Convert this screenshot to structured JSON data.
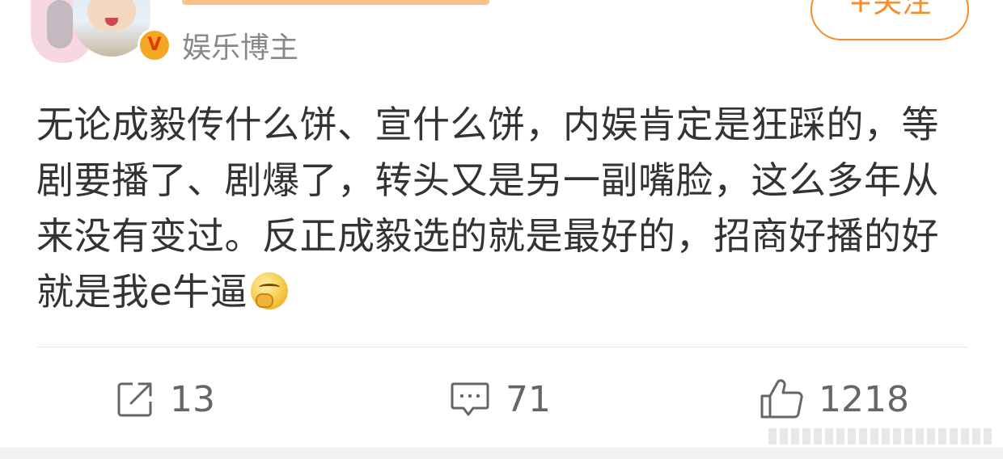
{
  "header": {
    "role": "娱乐博主",
    "verified_badge": "V",
    "follow_label": "+关注"
  },
  "post": {
    "text": "无论成毅传什么饼、宣什么饼，内娱肯定是狂踩的，等剧要播了、剧爆了，转头又是另一副嘴脸，这么多年从来没有变过。反正成毅选的就是最好的，招商好播的好就是我e牛逼",
    "emoji": "thinking-emoji"
  },
  "actions": {
    "repost": {
      "icon": "share-icon",
      "count": "13"
    },
    "comment": {
      "icon": "comment-icon",
      "count": "71"
    },
    "like": {
      "icon": "thumbs-up-icon",
      "count": "1218"
    }
  },
  "colors": {
    "accent": "#f58e2b",
    "text": "#333333",
    "secondary": "#888888"
  }
}
